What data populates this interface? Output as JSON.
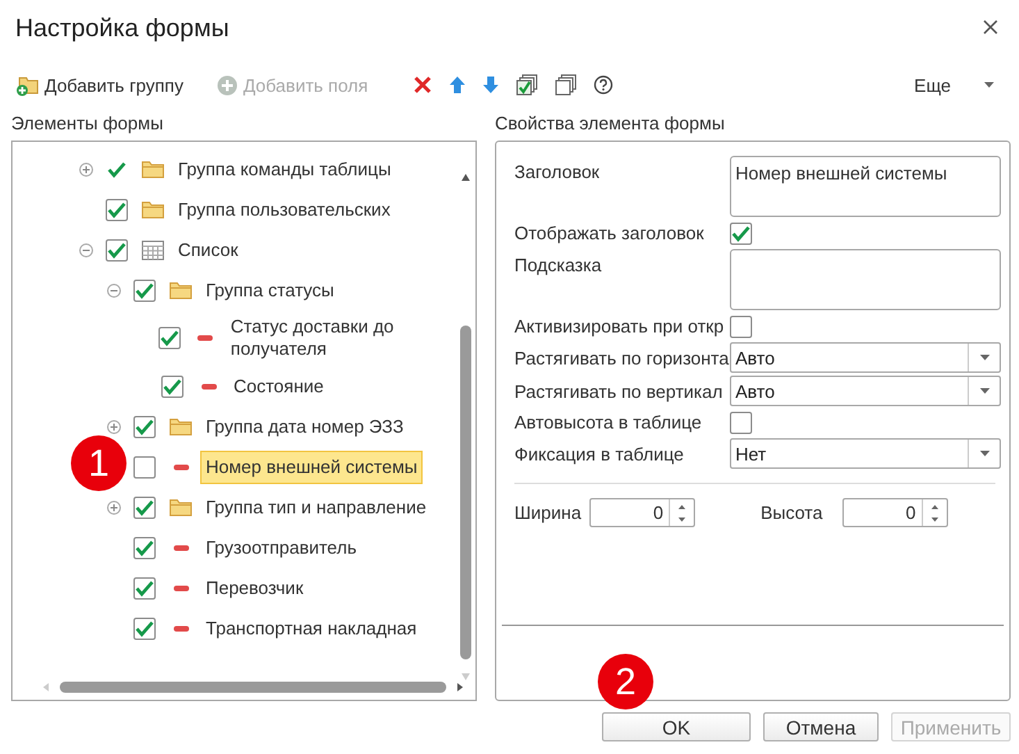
{
  "window": {
    "title": "Настройка формы"
  },
  "toolbar": {
    "add_group": {
      "label": "Добавить группу",
      "disabled": false
    },
    "add_fields": {
      "label": "Добавить поля",
      "disabled": true
    },
    "more": "Еще"
  },
  "elements_panel": {
    "title": "Элементы формы",
    "tree": [
      {
        "label": "Группа команды таблицы",
        "kind": "folder",
        "framed": false,
        "checked": true,
        "expanded": false,
        "selected": false
      },
      {
        "label": "Группа пользовательских",
        "kind": "folder",
        "framed": true,
        "checked": true,
        "selected": false
      },
      {
        "label": "Список",
        "kind": "table",
        "framed": true,
        "checked": true,
        "expanded": true,
        "selected": false,
        "children": [
          {
            "label": "Группа статусы",
            "kind": "folder",
            "framed": true,
            "checked": true,
            "expanded": true,
            "selected": false,
            "children": [
              {
                "label": "Статус доставки до получателя",
                "kind": "field",
                "framed": true,
                "checked": true,
                "selected": false
              },
              {
                "label": "Состояние",
                "kind": "field",
                "framed": true,
                "checked": true,
                "selected": false
              }
            ]
          },
          {
            "label": "Группа дата номер ЭЗЗ",
            "kind": "folder",
            "framed": true,
            "checked": true,
            "expanded": false,
            "selected": false
          },
          {
            "label": "Номер внешней системы",
            "kind": "field",
            "framed": true,
            "checked": false,
            "selected": true
          },
          {
            "label": "Группа тип и направление",
            "kind": "folder",
            "framed": true,
            "checked": true,
            "expanded": false,
            "selected": false
          },
          {
            "label": "Грузоотправитель",
            "kind": "field",
            "framed": true,
            "checked": true,
            "selected": false
          },
          {
            "label": "Перевозчик",
            "kind": "field",
            "framed": true,
            "checked": true,
            "selected": false
          },
          {
            "label": "Транспортная накладная",
            "kind": "field",
            "framed": true,
            "checked": true,
            "selected": false
          }
        ]
      }
    ]
  },
  "properties_panel": {
    "title": "Свойства элемента формы",
    "properties": [
      {
        "kind": "text",
        "label": "Заголовок",
        "value": "Номер внешней системы"
      },
      {
        "kind": "checkbox",
        "label": "Отображать заголовок",
        "checked": true
      },
      {
        "kind": "text",
        "label": "Подсказка"
      },
      {
        "kind": "checkbox",
        "label": "Активизировать при откр",
        "checked": false
      },
      {
        "kind": "select",
        "label": "Растягивать по горизонта",
        "value": "Авто"
      },
      {
        "kind": "select",
        "label": "Растягивать по вертикал",
        "value": "Авто"
      },
      {
        "kind": "checkbox",
        "label": "Автовысота в таблице",
        "checked": false
      },
      {
        "kind": "select",
        "label": "Фиксация в таблице",
        "value": "Нет"
      }
    ],
    "width": {
      "label": "Ширина",
      "value": "0"
    },
    "height": {
      "label": "Высота",
      "value": "0"
    }
  },
  "buttons": [
    {
      "label": "OK",
      "disabled": false
    },
    {
      "label": "Отмена",
      "disabled": false
    },
    {
      "label": "Применить",
      "disabled": true
    }
  ],
  "callouts": [
    {
      "label": "1"
    },
    {
      "label": "2"
    }
  ]
}
